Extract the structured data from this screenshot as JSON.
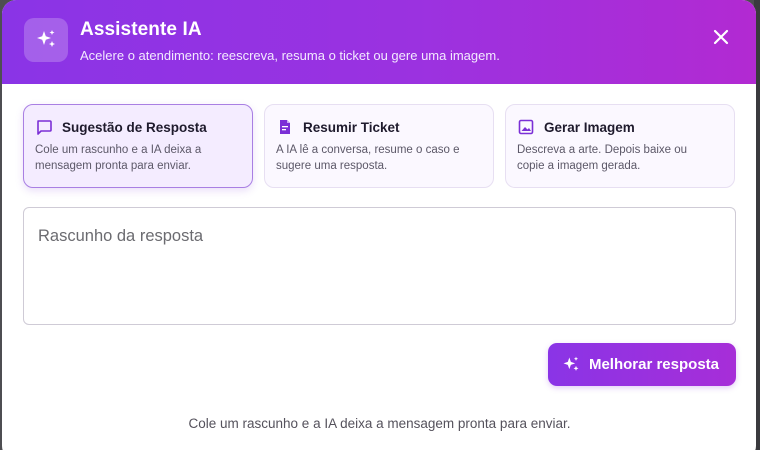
{
  "header": {
    "title": "Assistente IA",
    "subtitle": "Acelere o atendimento: reescreva, resuma o ticket ou gere uma imagem.",
    "icon": "sparkles-icon",
    "close_icon": "close-icon"
  },
  "modes": [
    {
      "icon": "chat-bubble-icon",
      "title": "Sugestão de Resposta",
      "description": "Cole um rascunho e a IA deixa a mensagem pronta para enviar.",
      "active": true
    },
    {
      "icon": "document-icon",
      "title": "Resumir Ticket",
      "description": "A IA lê a conversa, resume o caso e sugere uma resposta.",
      "active": false
    },
    {
      "icon": "image-icon",
      "title": "Gerar Imagem",
      "description": "Descreva a arte. Depois baixe ou copie a imagem gerada.",
      "active": false
    }
  ],
  "draft": {
    "placeholder": "Rascunho da resposta",
    "value": ""
  },
  "action": {
    "label": "Melhorar resposta",
    "icon": "sparkles-icon"
  },
  "hint": "Cole um rascunho e a IA deixa a mensagem pronta para enviar.",
  "colors": {
    "accent": "#8a34e6",
    "accent_end": "#b22ad2",
    "card_border_active": "#a97fe3"
  }
}
